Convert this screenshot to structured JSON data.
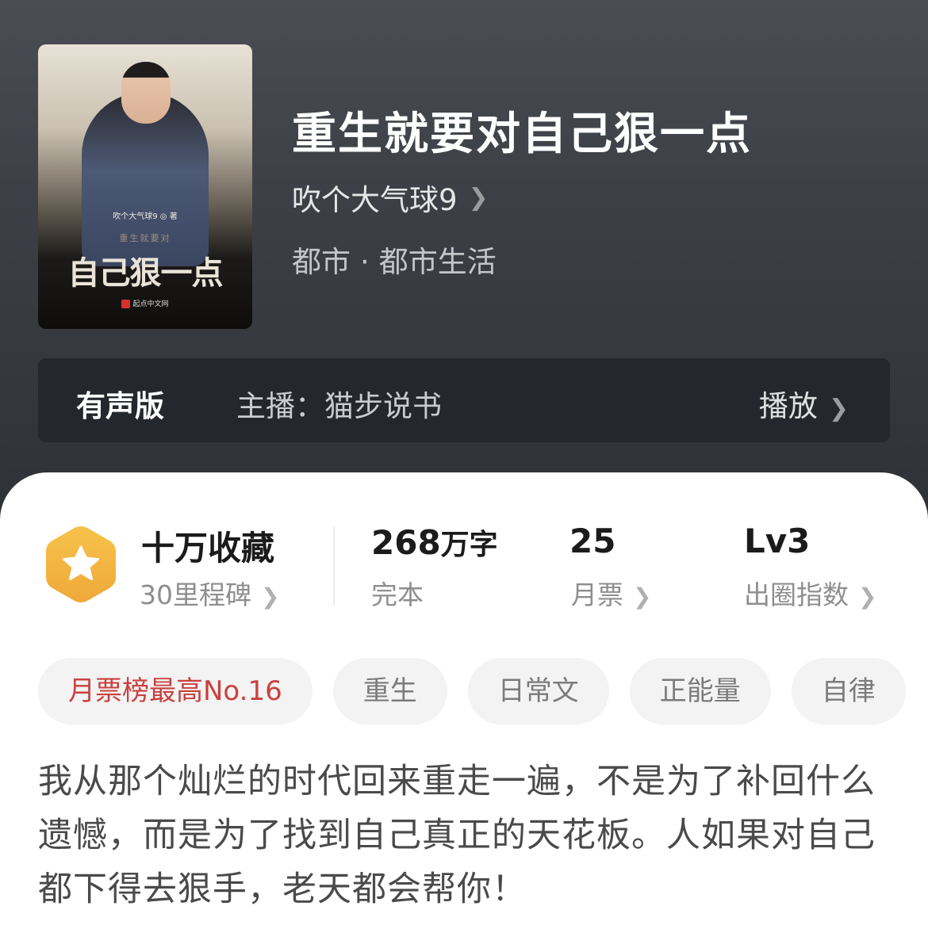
{
  "book": {
    "title": "重生就要对自己狠一点",
    "author": "吹个大气球9",
    "category": "都市",
    "subcategory": "都市生活",
    "cover": {
      "author_line": "吹个大气球9 ◎ 著",
      "sub_line": "重生就要对",
      "title_line": "自己狠一点",
      "publisher": "起点中文网"
    }
  },
  "audio": {
    "label": "有声版",
    "host": "主播：猫步说书",
    "play_label": "播放"
  },
  "stats": {
    "collect": {
      "title": "十万收藏",
      "sub": "30里程碑"
    },
    "words": {
      "value": "268",
      "unit": "万字",
      "sub": "完本"
    },
    "monthly": {
      "value": "25",
      "sub": "月票"
    },
    "level": {
      "value": "Lv3",
      "sub": "出圈指数"
    }
  },
  "tags": [
    "月票榜最高No.16",
    "重生",
    "日常文",
    "正能量",
    "自律"
  ],
  "description": "我从那个灿烂的时代回来重走一遍，不是为了补回什么遗憾，而是为了找到自己真正的天花板。人如果对自己都下得去狠手，老天都会帮你！",
  "colors": {
    "accent_red": "#c9403f",
    "badge_orange": "#f2b33d",
    "sheet_bg": "#ffffff",
    "hero_bg": "#3c3f45"
  },
  "icons": {
    "author_chevron": "chevron-right-icon",
    "badge": "star-hexagon-icon"
  }
}
